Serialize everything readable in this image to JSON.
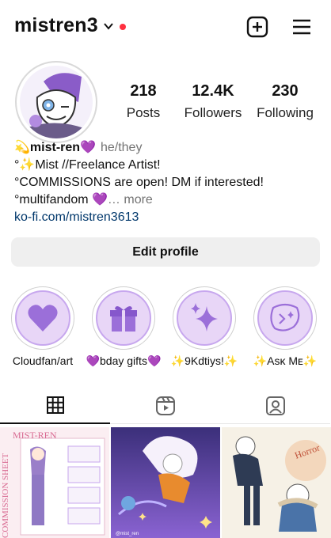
{
  "header": {
    "username": "mistren3",
    "icons": {
      "switch": "chevron-down-icon",
      "create": "add-square-icon",
      "menu": "hamburger-menu-icon"
    },
    "notification_color": "#ff3040"
  },
  "stats": [
    {
      "value": "218",
      "label": "Posts"
    },
    {
      "value": "12.4K",
      "label": "Followers"
    },
    {
      "value": "230",
      "label": "Following"
    }
  ],
  "bio": {
    "name": "💫mist-ren💜",
    "pronouns": "he/they",
    "line1": "°✨Mist //Freelance Artist!",
    "line2": "°COMMISSIONS are open! DM if interested!",
    "line3": " °multifandom 💜",
    "ellipsis": "…",
    "more": "more",
    "link": "ko-fi.com/mistren3613"
  },
  "edit_profile_label": "Edit profile",
  "highlights": [
    {
      "label": "Cloudfan/art",
      "icon": "heart-icon"
    },
    {
      "label": "💜bday gifts💜",
      "icon": "gift-icon"
    },
    {
      "label": "✨9Kdtiys!✨",
      "icon": "sparkles-icon"
    },
    {
      "label": "✨Aѕĸ Mᴇ✨",
      "icon": "chat-sparkle-icon"
    }
  ],
  "highlight_color": "#9b6fd9",
  "tabs": [
    {
      "name": "posts",
      "icon": "grid-icon",
      "active": true
    },
    {
      "name": "reels",
      "icon": "reels-icon",
      "active": false
    },
    {
      "name": "tagged",
      "icon": "tagged-person-icon",
      "active": false
    }
  ],
  "posts": [
    {
      "title": "MIST-REN",
      "side_text": "COMMISSION SHEET"
    },
    {
      "signature": "@mist_ren"
    },
    {
      "title": "Horror"
    }
  ]
}
